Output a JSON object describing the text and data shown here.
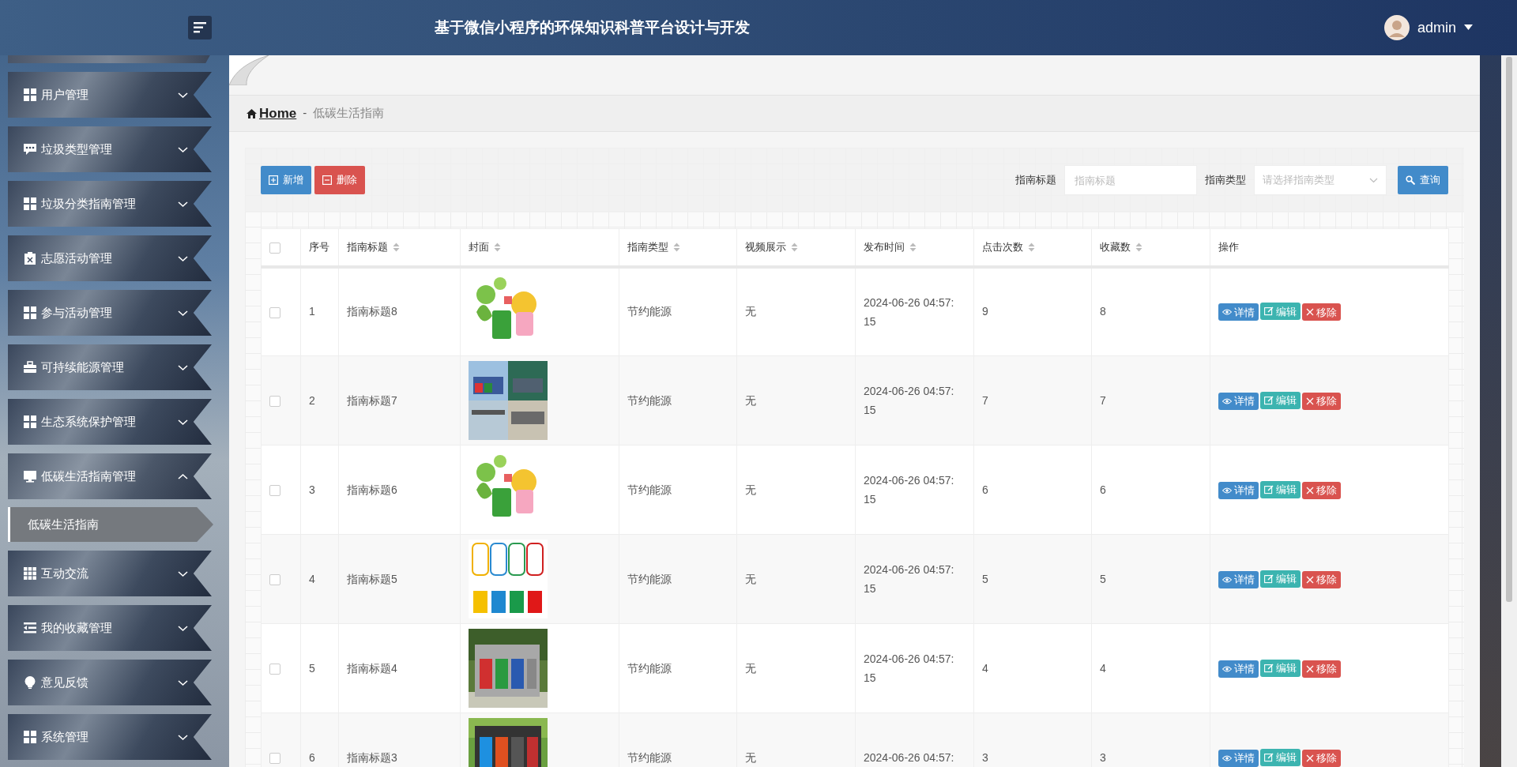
{
  "header": {
    "title": "基于微信小程序的环保知识科普平台设计与开发",
    "user": "admin"
  },
  "sidebar": {
    "items": [
      {
        "label": "用户管理",
        "expanded": false
      },
      {
        "label": "垃圾类型管理",
        "expanded": false
      },
      {
        "label": "垃圾分类指南管理",
        "expanded": false
      },
      {
        "label": "志愿活动管理",
        "expanded": false
      },
      {
        "label": "参与活动管理",
        "expanded": false
      },
      {
        "label": "可持续能源管理",
        "expanded": false
      },
      {
        "label": "生态系统保护管理",
        "expanded": false
      },
      {
        "label": "低碳生活指南管理",
        "expanded": true,
        "children": [
          {
            "label": "低碳生活指南",
            "selected": true
          }
        ]
      },
      {
        "label": "互动交流",
        "expanded": false
      },
      {
        "label": "我的收藏管理",
        "expanded": false
      },
      {
        "label": "意见反馈",
        "expanded": false
      },
      {
        "label": "系统管理",
        "expanded": false
      }
    ]
  },
  "breadcrumb": {
    "home": "Home",
    "separator": "-",
    "current": "低碳生活指南"
  },
  "toolbar": {
    "buttons": [
      "新增",
      "删除"
    ],
    "filters": [
      {
        "label": "指南标题",
        "placeholder": "指南标题",
        "kind": "text"
      },
      {
        "label": "指南类型",
        "placeholder": "请选择指南类型",
        "kind": "select"
      }
    ],
    "search": "查询"
  },
  "table": {
    "select_all": {
      "checked": false
    },
    "columns": [
      {
        "label": "序号",
        "sortable": false
      },
      {
        "label": "指南标题",
        "sortable": true
      },
      {
        "label": "封面",
        "sortable": true
      },
      {
        "label": "指南类型",
        "sortable": true
      },
      {
        "label": "视频展示",
        "sortable": true
      },
      {
        "label": "发布时间",
        "sortable": true
      },
      {
        "label": "点击次数",
        "sortable": true
      },
      {
        "label": "收藏数",
        "sortable": true
      },
      {
        "label": "操作",
        "sortable": false
      }
    ],
    "rows": [
      {
        "checked": false,
        "index": "1",
        "title": "指南标题8",
        "type": "节约能源",
        "video": "无",
        "time": "2024-06-26 04:57:15",
        "clicks": "9",
        "favorites": "8",
        "actions": [
          "详情",
          "编辑",
          "移除"
        ]
      },
      {
        "checked": false,
        "index": "2",
        "title": "指南标题7",
        "type": "节约能源",
        "video": "无",
        "time": "2024-06-26 04:57:15",
        "clicks": "7",
        "favorites": "7",
        "actions": [
          "详情",
          "编辑",
          "移除"
        ]
      },
      {
        "checked": false,
        "index": "3",
        "title": "指南标题6",
        "type": "节约能源",
        "video": "无",
        "time": "2024-06-26 04:57:15",
        "clicks": "6",
        "favorites": "6",
        "actions": [
          "详情",
          "编辑",
          "移除"
        ]
      },
      {
        "checked": false,
        "index": "4",
        "title": "指南标题5",
        "type": "节约能源",
        "video": "无",
        "time": "2024-06-26 04:57:15",
        "clicks": "5",
        "favorites": "5",
        "actions": [
          "详情",
          "编辑",
          "移除"
        ]
      },
      {
        "checked": false,
        "index": "5",
        "title": "指南标题4",
        "type": "节约能源",
        "video": "无",
        "time": "2024-06-26 04:57:15",
        "clicks": "4",
        "favorites": "4",
        "actions": [
          "详情",
          "编辑",
          "移除"
        ]
      },
      {
        "checked": false,
        "index": "6",
        "title": "指南标题3",
        "type": "节约能源",
        "video": "无",
        "time": "2024-06-26 04:57:",
        "clicks": "3",
        "favorites": "3",
        "actions": [
          "详情",
          "编辑",
          "移除"
        ]
      }
    ]
  }
}
